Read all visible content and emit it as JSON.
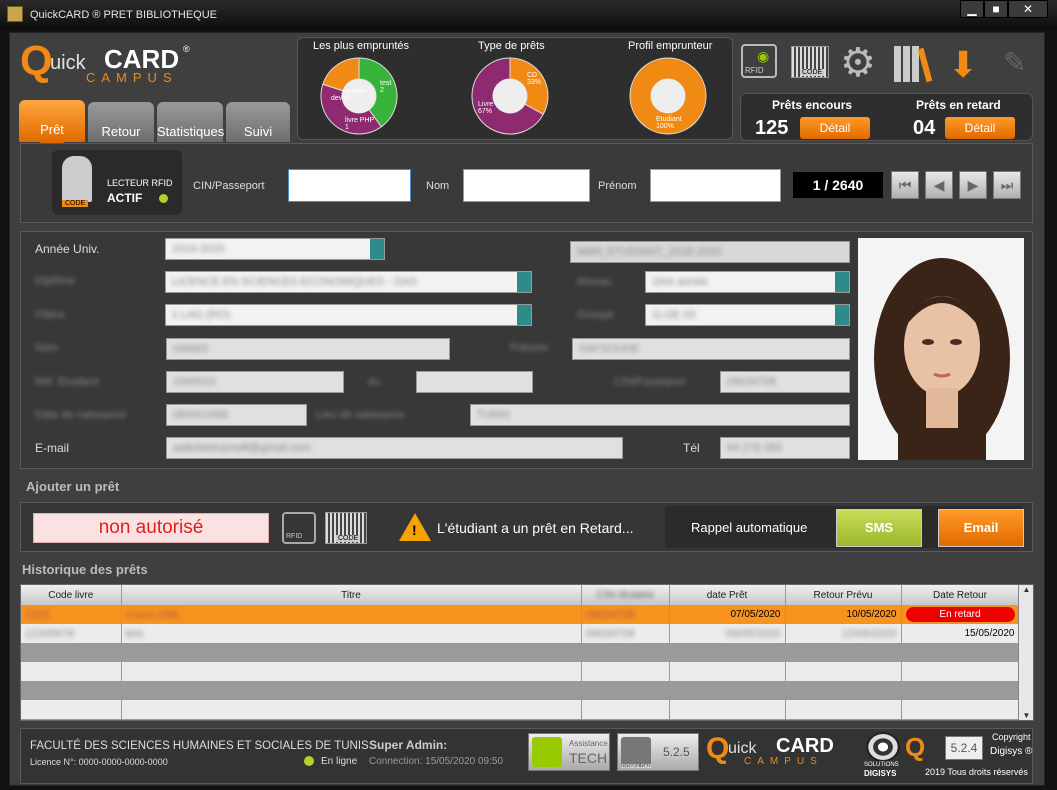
{
  "window": {
    "title": "QuickCARD ® PRET BIBLIOTHEQUE",
    "min": "▁",
    "max": "■",
    "close": "✕"
  },
  "logo": {
    "q": "Q",
    "uick": "uick",
    "card": "CARD",
    "reg": "®",
    "campus": "CAMPUS"
  },
  "tabs": [
    "Prêt",
    "Retour",
    "Statistiques",
    "Suivi"
  ],
  "charts": {
    "most": {
      "title": "Les plus empruntés",
      "labels": [
        "dev 2",
        "windev",
        "test 2",
        "livre PHP 1"
      ]
    },
    "types": {
      "title": "Type de prêts",
      "labels": [
        "CD 33%",
        "Livre 67%"
      ]
    },
    "profile": {
      "title": "Profil emprunteur",
      "labels": [
        "Etudiant 100%"
      ]
    }
  },
  "chart_data": [
    {
      "type": "pie",
      "title": "Les plus empruntés",
      "categories": [
        "dev",
        "windev",
        "test",
        "livre PHP"
      ],
      "values": [
        2,
        0,
        2,
        1
      ]
    },
    {
      "type": "pie",
      "title": "Type de prêts",
      "categories": [
        "CD",
        "Livre"
      ],
      "values": [
        33,
        67
      ]
    },
    {
      "type": "pie",
      "title": "Profil emprunteur",
      "categories": [
        "Etudiant"
      ],
      "values": [
        100
      ]
    }
  ],
  "toolbar": {
    "rfid": "RFID",
    "code": "CODE"
  },
  "stats": {
    "encours_label": "Prêts encours",
    "encours": "125",
    "retard_label": "Prêts en retard",
    "retard": "04",
    "detail": "Détail"
  },
  "reader": {
    "line1": "LECTEUR RFID",
    "line2": "ACTIF",
    "code": "CODE"
  },
  "search": {
    "cin": "CIN/Passeport",
    "nom": "Nom",
    "prenom": "Prénom",
    "counter": "1 / 2640"
  },
  "form": {
    "annee_label": "Année Univ.",
    "annee": "2016-2020",
    "id_right": "9689_ETUDIANT_2016-2020",
    "diplome_label": "Diplôme",
    "diplome": "LICENCE EN SCIENCES ECONOMIQUES - GAS",
    "niveau_label": "Niveau",
    "niveau": "1ère année",
    "filiere_label": "Filière",
    "filiere": "1 LAG (RO)",
    "groupe_label": "Groupe",
    "groupe": "1LGE 03",
    "nom_label": "Nom",
    "nom": "HAMDI",
    "prenom_label": "Prénom",
    "prenom": "SAFSOUHE",
    "ref_label": "Réf. Etudiant",
    "ref": "1500015",
    "du_label": "du",
    "du": "",
    "cin_label": "CIN/Passeport",
    "cin": "09034708",
    "dob_label": "Date de naissance",
    "dob": "08/04/1998",
    "lieu_label": "Lieu de naissance",
    "lieu": "TUNIS",
    "email_label": "E-mail",
    "email": "aaltobietnamelll@gmail.com",
    "tel_label": "Tél",
    "tel": "94 276 283"
  },
  "ajout": {
    "title": "Ajouter un prêt",
    "status": "non autorisé",
    "rfid": "RFID",
    "code": "CODE",
    "warning": "L'étudiant a un prêt en Retard...",
    "rappel": "Rappel automatique",
    "sms": "SMS",
    "email": "Email"
  },
  "historique": {
    "title": "Historique des prêts",
    "headers": [
      "Code livre",
      "Titre",
      "CIN titulaire",
      "date Prêt",
      "Retour Prévu",
      "Date Retour"
    ],
    "rows": [
      [
        "2222",
        "Cours UML",
        "09034708",
        "07/05/2020",
        "10/05/2020",
        "En retard"
      ],
      [
        "12345678",
        "test",
        "09034708",
        "09/05/2020",
        "12/05/2020",
        "15/05/2020"
      ]
    ]
  },
  "footer": {
    "faculty": "FACULTÉ DES SCIENCES HUMAINES ET SOCIALES DE TUNIS",
    "licence": "Licence N°: 0000-0000-0000-0000",
    "online": "En ligne",
    "admin": "Super Admin:",
    "connection": "Connection: 15/05/2020 09:50",
    "assist_small": "Assistance",
    "assist_big": "TECH",
    "version1": "5.2.5",
    "download": "DOWNLOAD",
    "digisys": "DIGISYS",
    "solutions": "SOLUTIONS",
    "version2": "5.2.4",
    "copyright": "Copyright",
    "company": "Digisys ®",
    "rights": "2019 Tous droits réservés"
  }
}
